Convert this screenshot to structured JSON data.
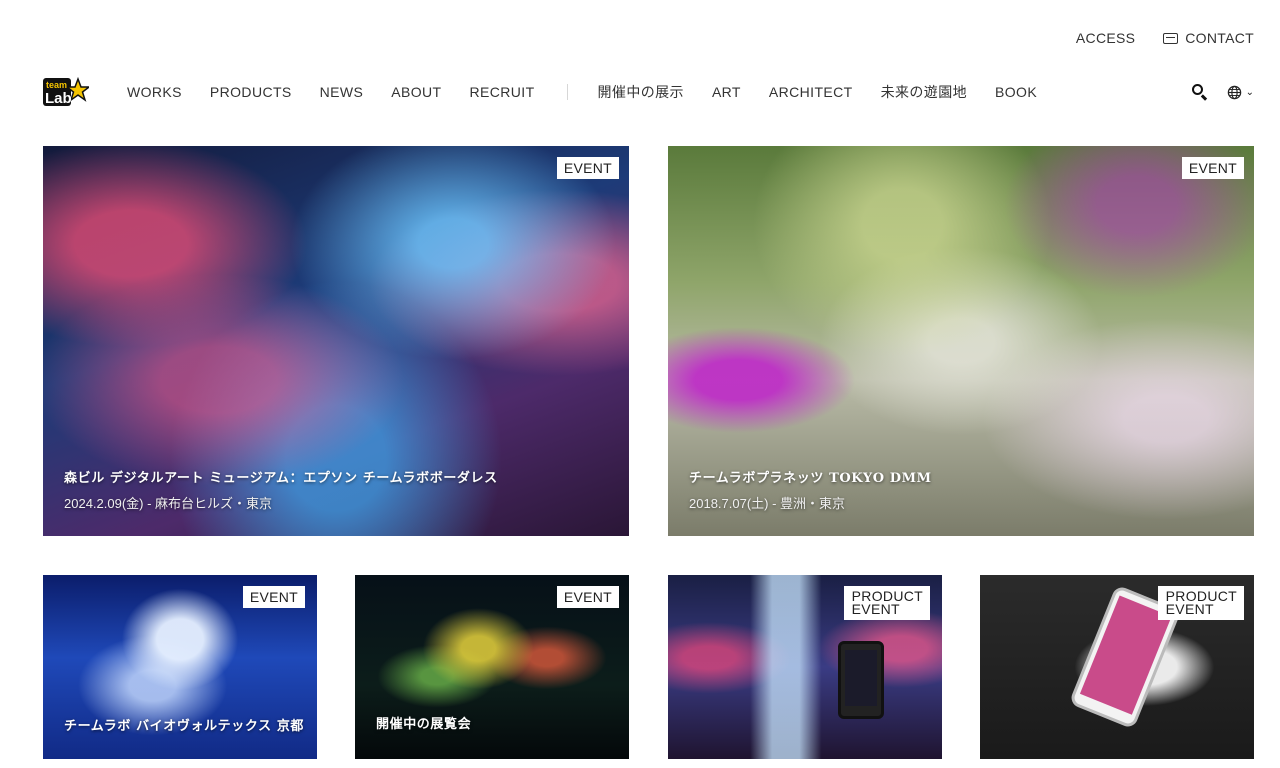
{
  "topbar": {
    "access_label": "ACCESS",
    "contact_label": "CONTACT"
  },
  "brand": {
    "logo_text_top": "team",
    "logo_text_bottom": "Lab"
  },
  "nav": {
    "items": [
      "WORKS",
      "PRODUCTS",
      "NEWS",
      "ABOUT",
      "RECRUIT"
    ],
    "items2": [
      "開催中の展示",
      "ART",
      "ARCHITECT",
      "未来の遊園地",
      "BOOK"
    ]
  },
  "cards": [
    {
      "badge": "EVENT",
      "title": "森ビル デジタルアート ミュージアム：エプソン チームラボボーダレス",
      "meta": "2024.2.09(金) - 麻布台ヒルズ・東京"
    },
    {
      "badge": "EVENT",
      "title": "チームラボプラネッツ TOKYO DMM",
      "meta": "2018.7.07(土) - 豊洲・東京"
    },
    {
      "badge": "EVENT",
      "title": "チームラボ バイオヴォルテックス 京都"
    },
    {
      "badge": "EVENT",
      "title": "開催中の展覧会"
    },
    {
      "badge_line1": "PRODUCT",
      "badge_line2": "EVENT"
    },
    {
      "badge_line1": "PRODUCT",
      "badge_line2": "EVENT"
    }
  ],
  "colors": {
    "accent": "#f5c400",
    "text": "#333333",
    "badge_bg": "#ffffff"
  },
  "icons": {
    "mail": "mail-icon",
    "search": "search-icon",
    "language": "globe-icon"
  }
}
